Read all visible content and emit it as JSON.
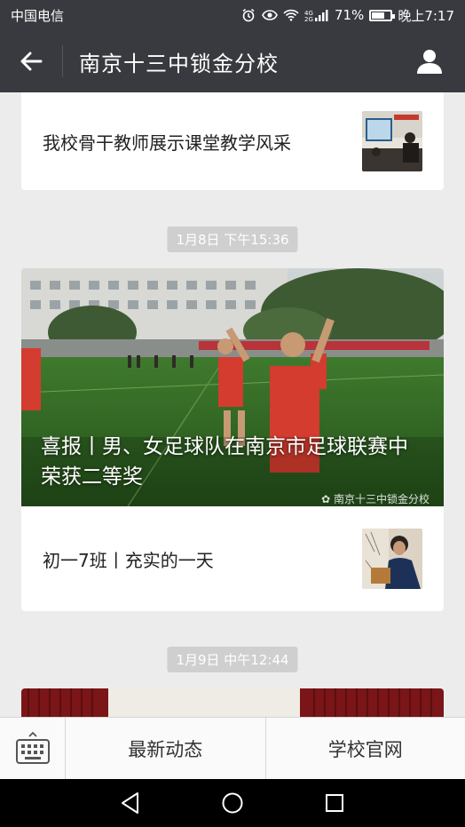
{
  "status_bar": {
    "carrier": "中国电信",
    "battery_percent": "71%",
    "battery_level": 0.71,
    "time": "晚上7:17",
    "icons": [
      "alarm-icon",
      "eye-icon",
      "wifi-icon",
      "4g-signal-icon",
      "battery-icon"
    ]
  },
  "header": {
    "title": "南京十三中锁金分校",
    "back_icon": "back-arrow-icon",
    "profile_icon": "profile-icon"
  },
  "feed": {
    "items": [
      {
        "type": "article",
        "title": "我校骨干教师展示课堂教学风采"
      },
      {
        "type": "timestamp",
        "text": "1月8日 下午15:36"
      },
      {
        "type": "featured",
        "headline": "喜报丨男、女足球队在南京市足球联赛中荣获二等奖",
        "watermark": "南京十三中锁金分校",
        "sub_item": {
          "title": "初一7班丨充实的一天"
        }
      },
      {
        "type": "timestamp",
        "text": "1月9日 中午12:44"
      }
    ]
  },
  "bottom_menu": {
    "keyboard_icon": "keyboard-icon",
    "items": [
      {
        "label": "最新动态"
      },
      {
        "label": "学校官网"
      }
    ]
  },
  "nav_bar": {
    "icons": [
      "back-triangle-icon",
      "home-circle-icon",
      "recents-square-icon"
    ]
  },
  "colors": {
    "header_bg": "#393a3f",
    "feed_bg": "#ececec",
    "card_bg": "#ffffff",
    "timestamp_bg": "#cfcfcf"
  }
}
